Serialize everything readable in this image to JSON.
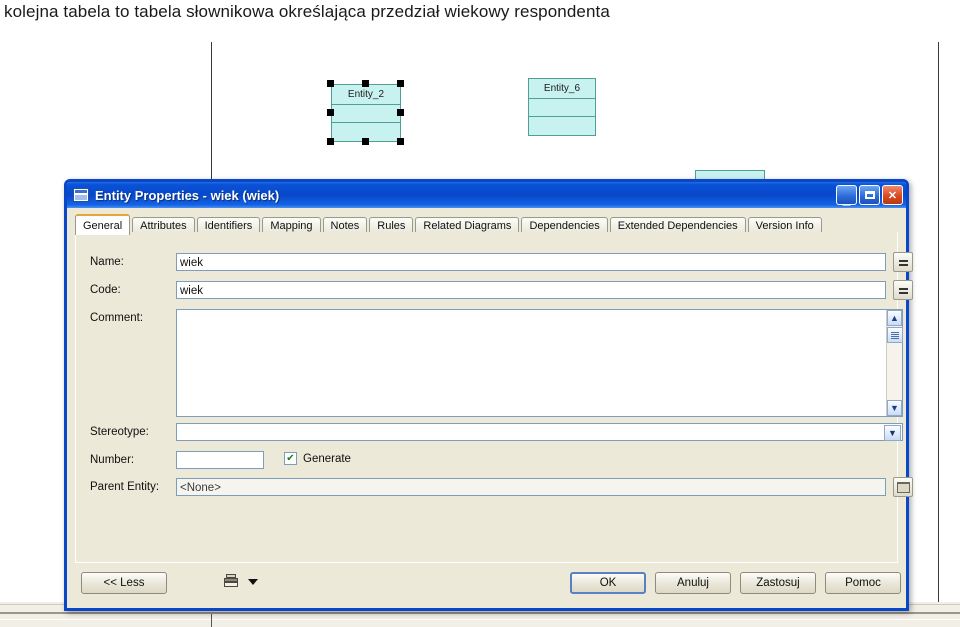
{
  "slide": {
    "caption": "kolejna tabela to tabela słownikowa określająca przedział wiekowy respondenta"
  },
  "background": {
    "entities": [
      {
        "name": "Entity_2",
        "selected": true
      },
      {
        "name": "Entity_6",
        "selected": false
      },
      {
        "name": "",
        "selected": false
      }
    ]
  },
  "dialog": {
    "title": "Entity Properties - wiek (wiek)",
    "icon": "entity-table-icon",
    "window_controls": {
      "minimize": "minimize-icon",
      "maximize": "maximize-icon",
      "close": "close-icon"
    },
    "tabs": [
      {
        "label": "General",
        "active": true
      },
      {
        "label": "Attributes",
        "active": false
      },
      {
        "label": "Identifiers",
        "active": false
      },
      {
        "label": "Mapping",
        "active": false
      },
      {
        "label": "Notes",
        "active": false
      },
      {
        "label": "Rules",
        "active": false
      },
      {
        "label": "Related Diagrams",
        "active": false
      },
      {
        "label": "Dependencies",
        "active": false
      },
      {
        "label": "Extended Dependencies",
        "active": false
      },
      {
        "label": "Version Info",
        "active": false
      }
    ],
    "fields": {
      "name": {
        "label": "Name:",
        "value": "wiek",
        "button": "="
      },
      "code": {
        "label": "Code:",
        "value": "wiek",
        "button": "="
      },
      "comment": {
        "label": "Comment:",
        "value": ""
      },
      "stereotype": {
        "label": "Stereotype:",
        "value": ""
      },
      "number": {
        "label": "Number:",
        "value": ""
      },
      "generate": {
        "label": "Generate",
        "checked": true,
        "mark": "✔"
      },
      "parent_entity": {
        "label": "Parent Entity:",
        "value": "<None>"
      }
    },
    "buttons": {
      "less": "<< Less",
      "ok": "OK",
      "cancel": "Anuluj",
      "apply": "Zastosuj",
      "help": "Pomoc"
    },
    "colors": {
      "titlebar": "#0a52d8",
      "dialog_face": "#ece9d8",
      "active_tab_accent": "#e8a33d",
      "entity_fill": "#c8f2ef",
      "entity_stroke": "#4f9e97"
    }
  }
}
